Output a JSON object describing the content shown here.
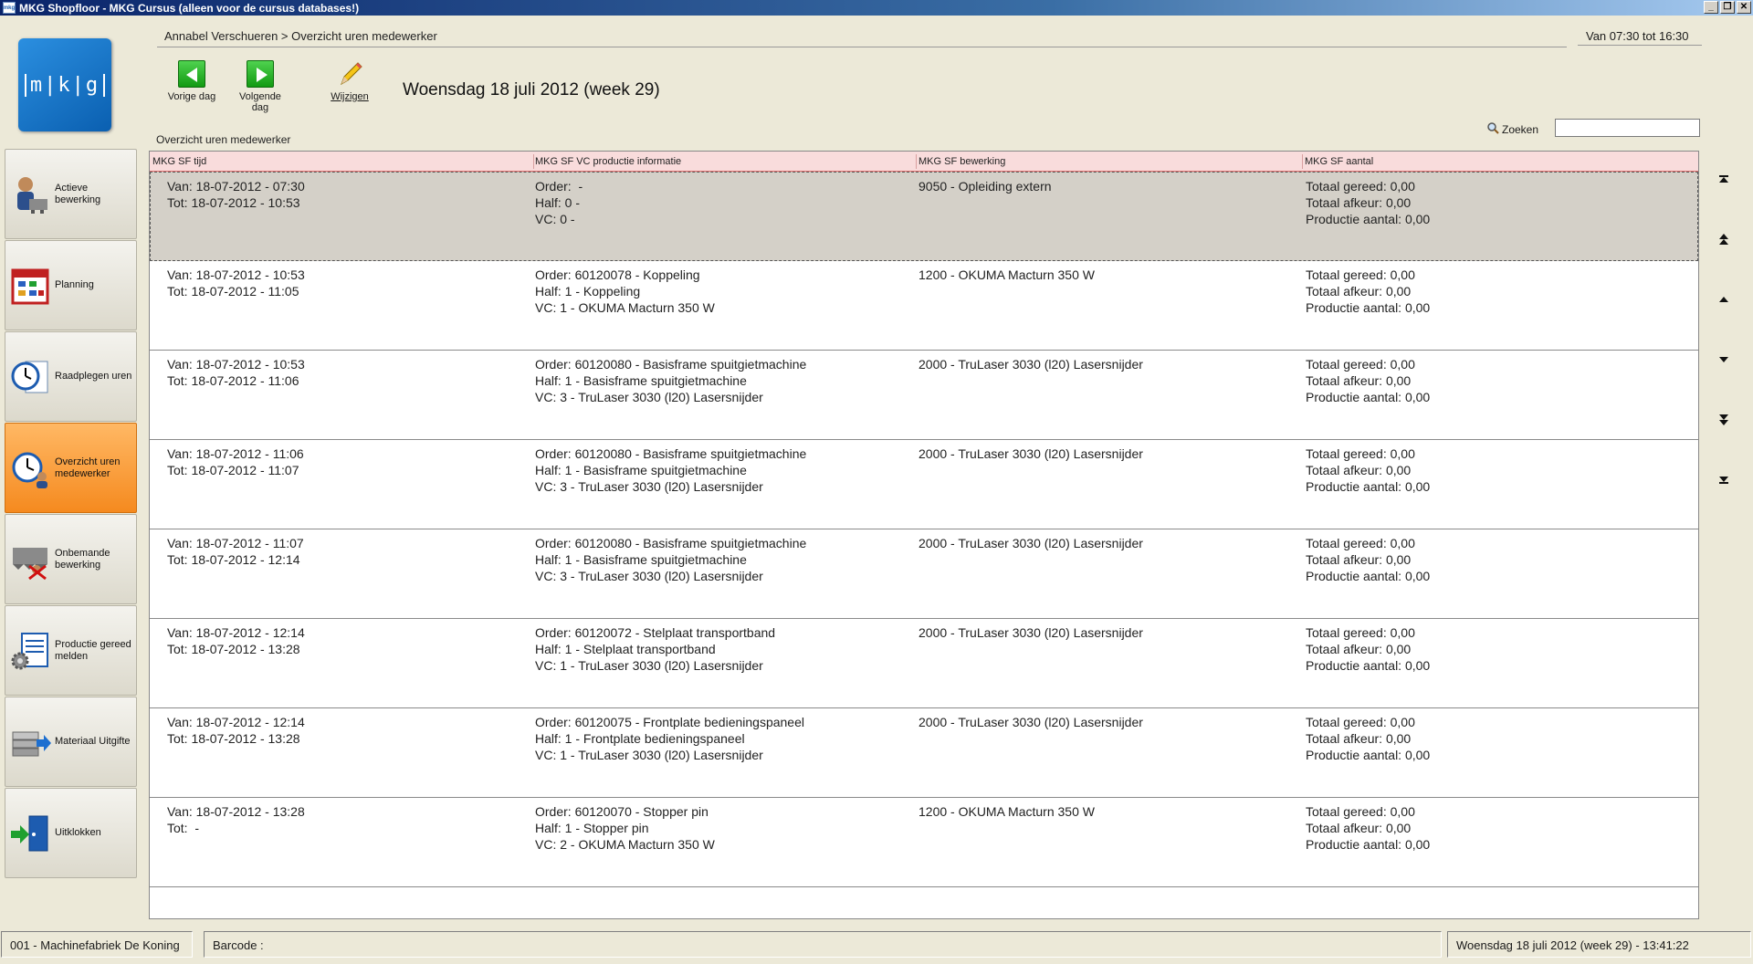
{
  "window": {
    "title": "MKG Shopfloor - MKG Cursus (alleen voor de cursus databases!)",
    "app_icon": "mkg"
  },
  "logo": {
    "text": "m|k|g"
  },
  "sidebar": {
    "items": [
      {
        "label": "Actieve bewerking",
        "icon": "worker-machine-icon",
        "active": false
      },
      {
        "label": "Planning",
        "icon": "calendar-icon",
        "active": false
      },
      {
        "label": "Raadplegen uren",
        "icon": "clock-document-icon",
        "active": false
      },
      {
        "label": "Overzicht uren medewerker",
        "icon": "clock-user-icon",
        "active": true
      },
      {
        "label": "Onbemande bewerking",
        "icon": "machine-unmanned-icon",
        "active": false
      },
      {
        "label": "Productie gereed melden",
        "icon": "document-gear-icon",
        "active": false
      },
      {
        "label": "Materiaal Uitgifte",
        "icon": "material-stack-icon",
        "active": false
      },
      {
        "label": "Uitklokken",
        "icon": "door-exit-icon",
        "active": false
      }
    ]
  },
  "header": {
    "breadcrumb": "Annabel Verschueren > Overzicht uren medewerker",
    "worktime": "Van 07:30 tot 16:30",
    "date_title": "Woensdag 18 juli 2012 (week 29)"
  },
  "toolbar": {
    "prev_label": "Vorige dag",
    "next_label": "Volgende dag",
    "edit_label": "Wijzigen"
  },
  "search": {
    "label": "Zoeken",
    "value": ""
  },
  "grid": {
    "caption": "Overzicht uren medewerker",
    "columns": [
      "MKG SF tijd",
      "MKG SF VC productie informatie",
      "MKG SF bewerking",
      "MKG SF aantal"
    ],
    "rows": [
      {
        "tijd": "Van: 18-07-2012 - 07:30\nTot: 18-07-2012 - 10:53",
        "info": "Order:  -\nHalf: 0 -\nVC: 0 -",
        "bewerking": "9050 - Opleiding extern",
        "aantal": "Totaal gereed: 0,00\nTotaal afkeur: 0,00\nProductie aantal: 0,00"
      },
      {
        "tijd": "Van: 18-07-2012 - 10:53\nTot: 18-07-2012 - 11:05",
        "info": "Order: 60120078 - Koppeling\nHalf: 1 - Koppeling\nVC: 1 - OKUMA Macturn 350 W",
        "bewerking": "1200 - OKUMA Macturn 350 W",
        "aantal": "Totaal gereed: 0,00\nTotaal afkeur: 0,00\nProductie aantal: 0,00"
      },
      {
        "tijd": "Van: 18-07-2012 - 10:53\nTot: 18-07-2012 - 11:06",
        "info": "Order: 60120080 - Basisframe spuitgietmachine\nHalf: 1 - Basisframe spuitgietmachine\nVC: 3 - TruLaser 3030 (l20) Lasersnijder",
        "bewerking": "2000 - TruLaser 3030 (l20) Lasersnijder",
        "aantal": "Totaal gereed: 0,00\nTotaal afkeur: 0,00\nProductie aantal: 0,00"
      },
      {
        "tijd": "Van: 18-07-2012 - 11:06\nTot: 18-07-2012 - 11:07",
        "info": "Order: 60120080 - Basisframe spuitgietmachine\nHalf: 1 - Basisframe spuitgietmachine\nVC: 3 - TruLaser 3030 (l20) Lasersnijder",
        "bewerking": "2000 - TruLaser 3030 (l20) Lasersnijder",
        "aantal": "Totaal gereed: 0,00\nTotaal afkeur: 0,00\nProductie aantal: 0,00"
      },
      {
        "tijd": "Van: 18-07-2012 - 11:07\nTot: 18-07-2012 - 12:14",
        "info": "Order: 60120080 - Basisframe spuitgietmachine\nHalf: 1 - Basisframe spuitgietmachine\nVC: 3 - TruLaser 3030 (l20) Lasersnijder",
        "bewerking": "2000 - TruLaser 3030 (l20) Lasersnijder",
        "aantal": "Totaal gereed: 0,00\nTotaal afkeur: 0,00\nProductie aantal: 0,00"
      },
      {
        "tijd": "Van: 18-07-2012 - 12:14\nTot: 18-07-2012 - 13:28",
        "info": "Order: 60120072 - Stelplaat transportband\nHalf: 1 - Stelplaat transportband\nVC: 1 - TruLaser 3030 (l20) Lasersnijder",
        "bewerking": "2000 - TruLaser 3030 (l20) Lasersnijder",
        "aantal": "Totaal gereed: 0,00\nTotaal afkeur: 0,00\nProductie aantal: 0,00"
      },
      {
        "tijd": "Van: 18-07-2012 - 12:14\nTot: 18-07-2012 - 13:28",
        "info": "Order: 60120075 - Frontplate bedieningspaneel\nHalf: 1 - Frontplate bedieningspaneel\nVC: 1 - TruLaser 3030 (l20) Lasersnijder",
        "bewerking": "2000 - TruLaser 3030 (l20) Lasersnijder",
        "aantal": "Totaal gereed: 0,00\nTotaal afkeur: 0,00\nProductie aantal: 0,00"
      },
      {
        "tijd": "Van: 18-07-2012 - 13:28\nTot:  -",
        "info": "Order: 60120070 - Stopper pin\nHalf: 1 - Stopper pin\nVC: 2 - OKUMA Macturn 350 W",
        "bewerking": "1200 - OKUMA Macturn 350 W",
        "aantal": "Totaal gereed: 0,00\nTotaal afkeur: 0,00\nProductie aantal: 0,00"
      }
    ]
  },
  "statusbar": {
    "company": "001 - Machinefabriek De Koning",
    "barcode_label": "Barcode :",
    "datetime": "Woensdag 18 juli 2012 (week 29) - 13:41:22"
  },
  "colors": {
    "active_nav": "#f58a1f",
    "grid_header": "#f9dcdc",
    "selected_row": "#d4d0c8",
    "title_bar": "#0a246a"
  }
}
